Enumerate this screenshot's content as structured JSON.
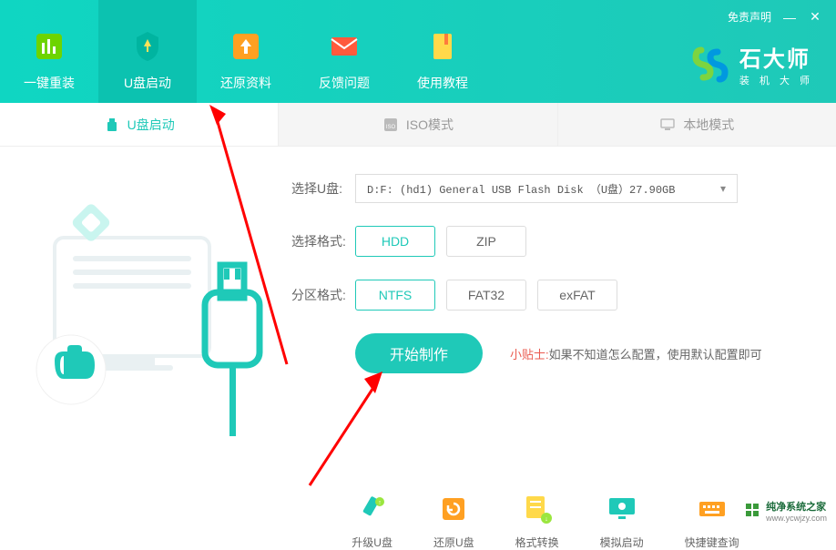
{
  "header": {
    "disclaimer": "免责声明",
    "brand_title": "石大师",
    "brand_sub": "装 机 大 师",
    "nav": [
      {
        "label": "一键重装"
      },
      {
        "label": "U盘启动"
      },
      {
        "label": "还原资料"
      },
      {
        "label": "反馈问题"
      },
      {
        "label": "使用教程"
      }
    ]
  },
  "subnav": [
    {
      "label": "U盘启动"
    },
    {
      "label": "ISO模式"
    },
    {
      "label": "本地模式"
    }
  ],
  "form": {
    "select_label": "选择U盘:",
    "select_value": "D:F: (hd1) General USB Flash Disk （U盘）27.90GB",
    "format_label": "选择格式:",
    "format_options": [
      "HDD",
      "ZIP"
    ],
    "partition_label": "分区格式:",
    "partition_options": [
      "NTFS",
      "FAT32",
      "exFAT"
    ],
    "start_button": "开始制作",
    "tip_label": "小贴士:",
    "tip_text": "如果不知道怎么配置，使用默认配置即可"
  },
  "bottom": [
    {
      "label": "升级U盘"
    },
    {
      "label": "还原U盘"
    },
    {
      "label": "格式转换"
    },
    {
      "label": "模拟启动"
    },
    {
      "label": "快捷键查询"
    }
  ],
  "footer": {
    "site_name": "纯净系统之家",
    "site_url": "www.ycwjzy.com"
  }
}
